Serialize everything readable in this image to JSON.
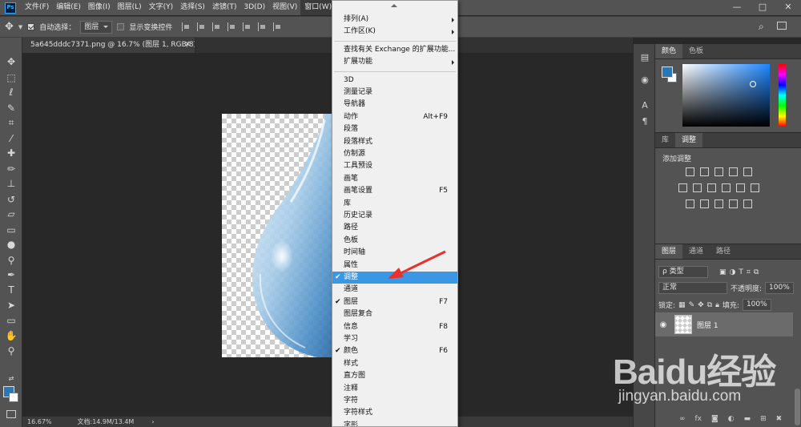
{
  "menubar": {
    "logo": "Ps",
    "items": [
      "文件(F)",
      "编辑(E)",
      "图像(I)",
      "图层(L)",
      "文字(Y)",
      "选择(S)",
      "滤镜(T)",
      "3D(D)",
      "视图(V)",
      "窗口(W)"
    ],
    "window_controls": [
      "—",
      "□",
      "✕"
    ]
  },
  "options_bar": {
    "auto_select_label": "自动选择：",
    "auto_select_value": "图层",
    "show_transform_label": "显示变换控件"
  },
  "document": {
    "tab_title": "5a645dddc7371.png @ 16.7% (图层 1, RGB/8) *",
    "zoom": "16.67%",
    "doc_size": "文档:14.9M/13.4M"
  },
  "window_menu": {
    "items": [
      {
        "label": "排列(A)",
        "submenu": true
      },
      {
        "label": "工作区(K)",
        "submenu": true
      },
      {
        "sep": true
      },
      {
        "label": "查找有关 Exchange 的扩展功能..."
      },
      {
        "label": "扩展功能",
        "submenu": true
      },
      {
        "sep": true
      },
      {
        "label": "3D"
      },
      {
        "label": "测量记录"
      },
      {
        "label": "导航器"
      },
      {
        "label": "动作",
        "shortcut": "Alt+F9"
      },
      {
        "label": "段落"
      },
      {
        "label": "段落样式"
      },
      {
        "label": "仿制源"
      },
      {
        "label": "工具预设"
      },
      {
        "label": "画笔"
      },
      {
        "label": "画笔设置",
        "shortcut": "F5"
      },
      {
        "label": "库"
      },
      {
        "label": "历史记录"
      },
      {
        "label": "路径"
      },
      {
        "label": "色板"
      },
      {
        "label": "时间轴"
      },
      {
        "label": "属性"
      },
      {
        "label": "调整",
        "checked": true,
        "highlighted": true
      },
      {
        "label": "通道"
      },
      {
        "label": "图层",
        "checked": true,
        "shortcut": "F7"
      },
      {
        "label": "图层复合"
      },
      {
        "label": "信息",
        "shortcut": "F8"
      },
      {
        "label": "学习"
      },
      {
        "label": "颜色",
        "checked": true,
        "shortcut": "F6"
      },
      {
        "label": "样式"
      },
      {
        "label": "直方图"
      },
      {
        "label": "注释"
      },
      {
        "label": "字符"
      },
      {
        "label": "字符样式"
      },
      {
        "label": "字形"
      }
    ]
  },
  "color_panel": {
    "tabs": [
      "颜色",
      "色板"
    ],
    "fg_color": "#2a77b6",
    "bg_color": "#ffffff"
  },
  "adjust_panel": {
    "tabs": [
      "库",
      "调整"
    ],
    "title": "添加调整"
  },
  "layers_panel": {
    "tabs": [
      "图层",
      "通道",
      "路径"
    ],
    "filter": "ρ 类型",
    "blend_mode": "正常",
    "opacity_label": "不透明度:",
    "opacity": "100%",
    "lock_label": "锁定:",
    "fill_label": "填充:",
    "fill": "100%",
    "layer_name": "图层 1"
  },
  "watermark": {
    "brand": "Baidu经验",
    "url": "jingyan.baidu.com"
  },
  "colors": {
    "highlight": "#3b97e3",
    "arrow": "#e8322b"
  }
}
